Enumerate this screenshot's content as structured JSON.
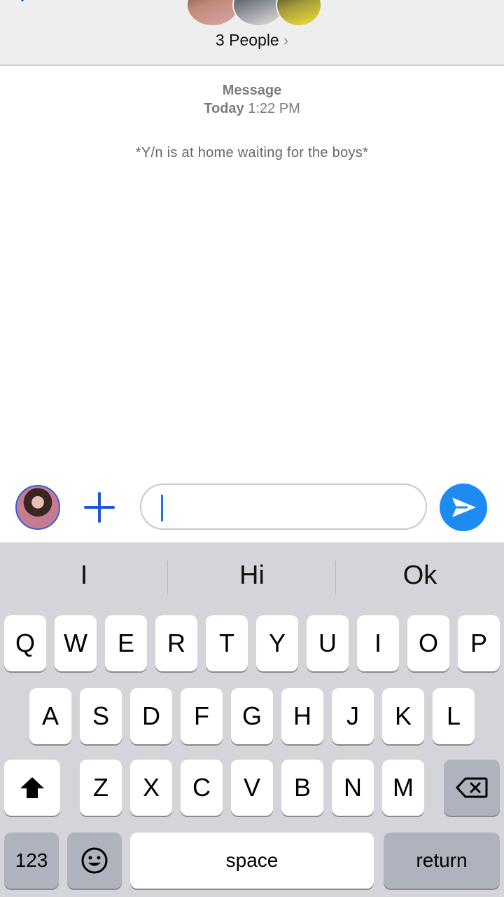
{
  "header": {
    "group_title": "3 People",
    "chevron": "›"
  },
  "conversation": {
    "service_label": "Message",
    "timestamp_day": "Today",
    "timestamp_time": "1:22 PM",
    "messages": [
      {
        "text": "*Y/n is at home waiting for the boys*"
      }
    ]
  },
  "compose": {
    "text": "",
    "plus_icon": "plus-icon",
    "send_icon": "send-arrow-icon"
  },
  "keyboard": {
    "suggestions": [
      "I",
      "Hi",
      "Ok"
    ],
    "row1": [
      "Q",
      "W",
      "E",
      "R",
      "T",
      "Y",
      "U",
      "I",
      "O",
      "P"
    ],
    "row2": [
      "A",
      "S",
      "D",
      "F",
      "G",
      "H",
      "J",
      "K",
      "L"
    ],
    "row3": [
      "Z",
      "X",
      "C",
      "V",
      "B",
      "N",
      "M"
    ],
    "numbers_label": "123",
    "space_label": "space",
    "return_label": "return"
  },
  "colors": {
    "accent": "#1d8bf1",
    "keyboard_bg": "#d3d5db"
  }
}
